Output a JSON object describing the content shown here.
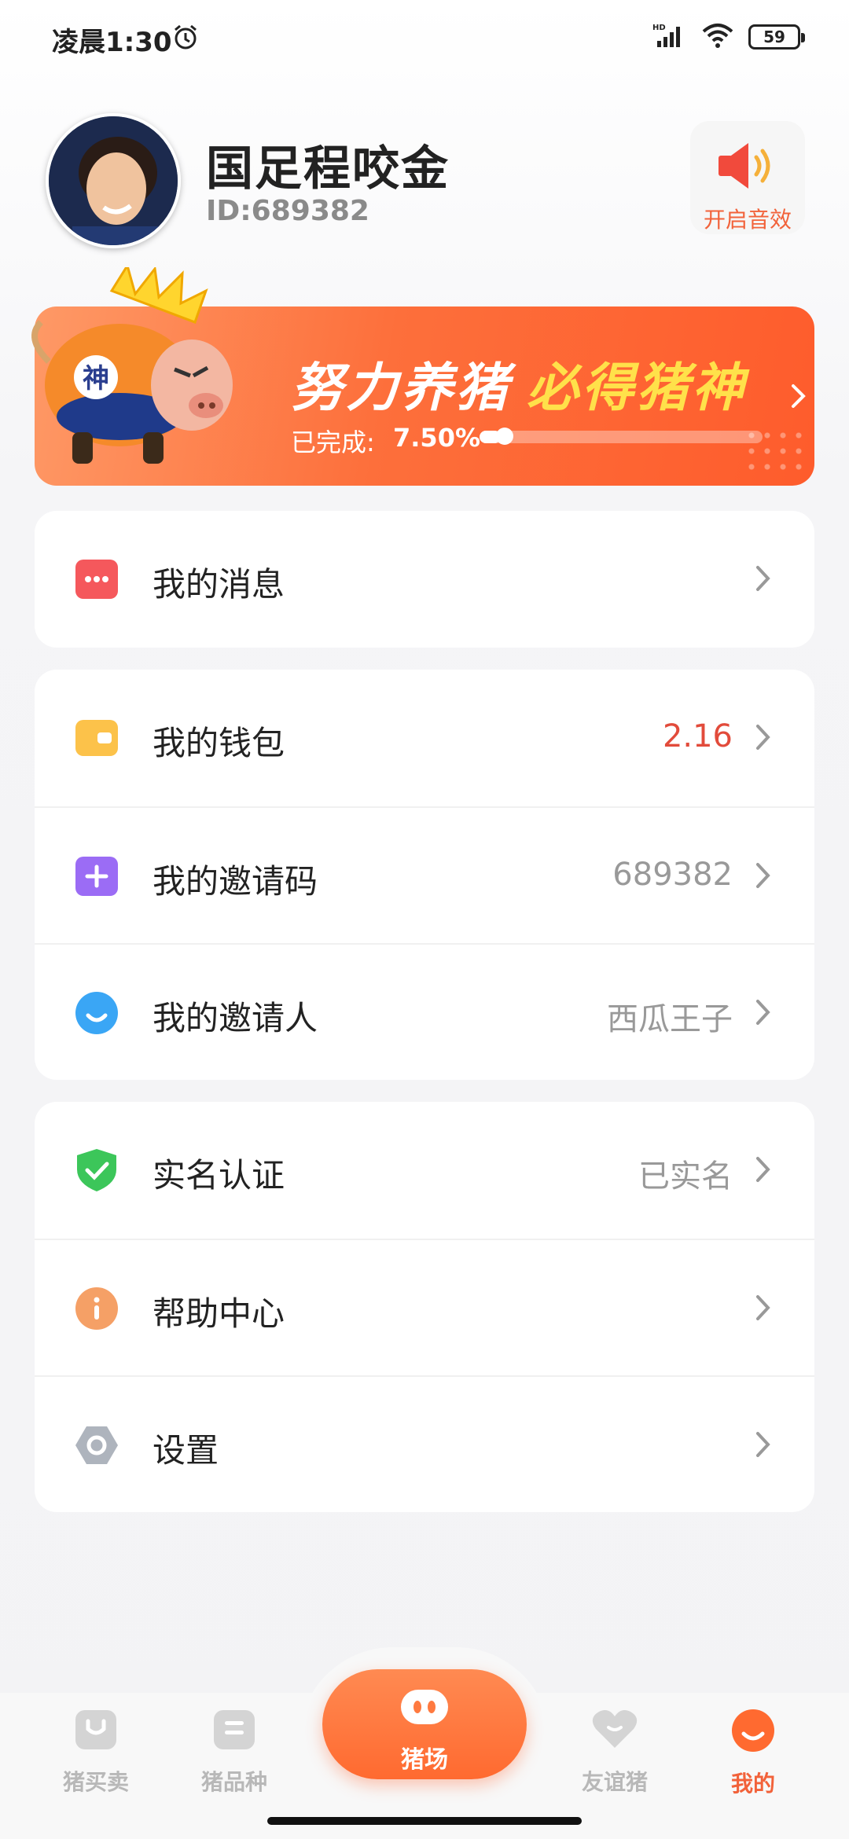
{
  "status_bar": {
    "time": "凌晨1:30",
    "battery": "59"
  },
  "profile": {
    "name": "国足程咬金",
    "id": "ID:689382",
    "sound_label": "开启音效"
  },
  "banner": {
    "title_part1": "努力养猪",
    "title_part2": "必得猪神",
    "progress_label": "已完成: ",
    "progress_value": "7.50%",
    "progress_fraction": 0.075,
    "pig_badge": "神"
  },
  "menu": {
    "messages": {
      "label": "我的消息",
      "value": ""
    },
    "wallet": {
      "label": "我的钱包",
      "value": "2.16"
    },
    "invite_code": {
      "label": "我的邀请码",
      "value": "689382"
    },
    "inviter": {
      "label": "我的邀请人",
      "value": "西瓜王子"
    },
    "verify": {
      "label": "实名认证",
      "value": "已实名"
    },
    "help": {
      "label": "帮助中心",
      "value": ""
    },
    "settings": {
      "label": "设置",
      "value": ""
    }
  },
  "nav": {
    "items": [
      {
        "label": "猪买卖"
      },
      {
        "label": "猪品种"
      },
      {
        "label": "猪场"
      },
      {
        "label": "友谊猪"
      },
      {
        "label": "我的"
      }
    ],
    "active_index": 4
  },
  "colors": {
    "accent": "#f2623a",
    "value_red": "#e24b3b",
    "banner_yellow": "#ffe14a"
  }
}
